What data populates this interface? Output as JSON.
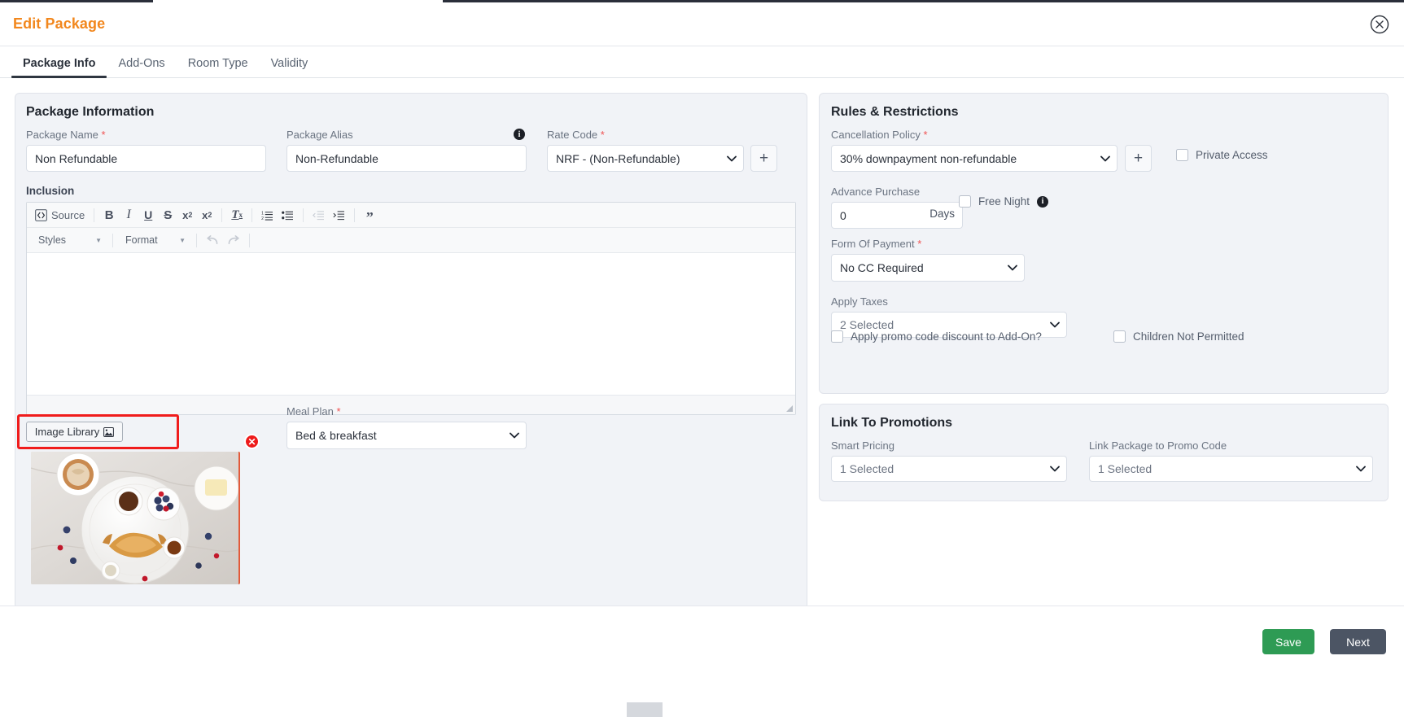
{
  "header": {
    "title": "Edit Package",
    "close_icon": "close-circle-icon"
  },
  "tabs": [
    {
      "label": "Package Info",
      "active": true
    },
    {
      "label": "Add-Ons",
      "active": false
    },
    {
      "label": "Room Type",
      "active": false
    },
    {
      "label": "Validity",
      "active": false
    }
  ],
  "package_information": {
    "title": "Package Information",
    "package_name": {
      "label": "Package Name",
      "required": true,
      "value": "Non Refundable"
    },
    "package_alias": {
      "label": "Package Alias",
      "required": false,
      "value": "Non-Refundable",
      "info_icon": "info-icon"
    },
    "rate_code": {
      "label": "Rate Code",
      "required": true,
      "value": "NRF - (Non-Refundable)",
      "add_button": "+"
    },
    "inclusion": {
      "label": "Inclusion",
      "value": "",
      "toolbar": {
        "source_label": "Source",
        "source_icon": "source-code-icon",
        "buttons": [
          {
            "name": "bold-icon",
            "glyph": "B"
          },
          {
            "name": "italic-icon",
            "glyph": "I"
          },
          {
            "name": "underline-icon",
            "glyph": "U"
          },
          {
            "name": "strikethrough-icon",
            "glyph": "S"
          },
          {
            "name": "subscript-icon",
            "glyph": "x₂"
          },
          {
            "name": "superscript-icon",
            "glyph": "x²"
          },
          {
            "name": "remove-format-icon",
            "glyph": "Tₓ"
          },
          {
            "name": "numbered-list-icon",
            "glyph": "1≡"
          },
          {
            "name": "bulleted-list-icon",
            "glyph": "•≡"
          },
          {
            "name": "decrease-indent-icon",
            "glyph": "⇤"
          },
          {
            "name": "increase-indent-icon",
            "glyph": "⇥"
          },
          {
            "name": "blockquote-icon",
            "glyph": "”"
          }
        ],
        "styles_label": "Styles",
        "format_label": "Format",
        "undo_icon": "undo-icon",
        "redo_icon": "redo-icon"
      }
    },
    "image_library": {
      "label": "Image Library",
      "icon": "image-icon",
      "highlighted": true,
      "thumbnail_alt": "breakfast-plate-thumbnail",
      "delete_icon": "delete-image-icon"
    },
    "meal_plan": {
      "label": "Meal Plan",
      "required": true,
      "value": "Bed & breakfast"
    }
  },
  "rules_restrictions": {
    "title": "Rules & Restrictions",
    "cancellation_policy": {
      "label": "Cancellation Policy",
      "required": true,
      "value": "30% downpayment non-refundable",
      "add_button": "+"
    },
    "private_access": {
      "label": "Private Access",
      "checked": false
    },
    "advance_purchase": {
      "label": "Advance Purchase",
      "value": "0",
      "unit": "Days"
    },
    "free_night": {
      "label": "Free Night",
      "checked": false,
      "info_icon": "info-icon"
    },
    "form_of_payment": {
      "label": "Form Of Payment",
      "required": true,
      "value": "No CC Required"
    },
    "apply_taxes": {
      "label": "Apply Taxes",
      "value": "2 Selected"
    },
    "apply_promo_discount": {
      "label": "Apply promo code discount to Add-On?",
      "checked": false
    },
    "children_not_permitted": {
      "label": "Children Not Permitted",
      "checked": false
    }
  },
  "link_to_promotions": {
    "title": "Link To Promotions",
    "smart_pricing": {
      "label": "Smart Pricing",
      "value": "1 Selected"
    },
    "link_package_promo": {
      "label": "Link Package to Promo Code",
      "value": "1 Selected"
    }
  },
  "footer": {
    "save_label": "Save",
    "next_label": "Next",
    "save_color": "#2e9b54",
    "next_color": "#4c5564"
  },
  "theme": {
    "accent": "#f2871d",
    "panel_bg": "#f1f3f7",
    "required_marker": "#f05252",
    "annotation": "#f01c1c"
  }
}
